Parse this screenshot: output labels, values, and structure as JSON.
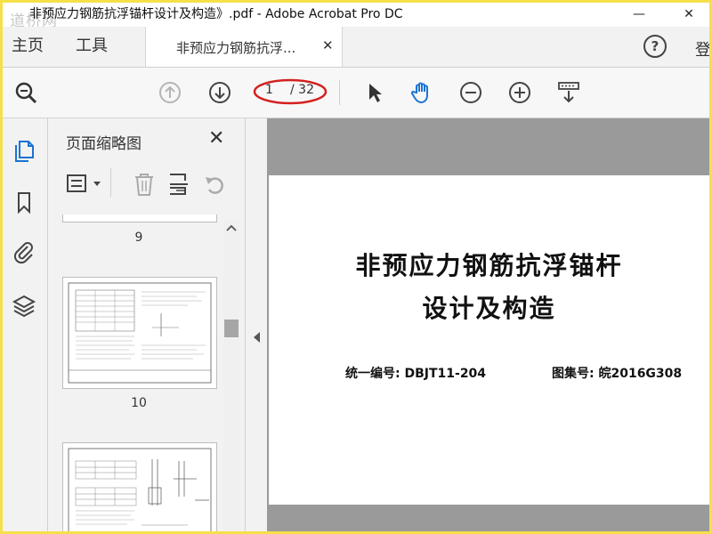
{
  "window": {
    "title": "非预应力钢筋抗浮锚杆设计及构造》.pdf - Adobe Acrobat Pro DC",
    "watermark": "道桥网",
    "minimize": "—",
    "close": "✕"
  },
  "tabbar": {
    "home": "主页",
    "tools": "工具",
    "doc_tab": "非预应力钢筋抗浮...",
    "doc_tab_close": "✕",
    "help": "?",
    "signin": "登"
  },
  "toolbar": {
    "current_page": "1",
    "total_pages": "/ 32"
  },
  "panel": {
    "title": "页面缩略图",
    "close": "✕",
    "thumbnails": [
      {
        "number": "9"
      },
      {
        "number": "10"
      }
    ]
  },
  "document": {
    "title_line1": "非预应力钢筋抗浮锚杆",
    "title_line2": "设计及构造",
    "code": "统一编号: DBJT11-204",
    "atlas": "图集号: 皖2016G308"
  },
  "colors": {
    "frame_border": "#f5e04a",
    "accent_blue": "#1b73d3",
    "annotation_red": "#d42020",
    "doc_background": "#9a9a9a"
  }
}
